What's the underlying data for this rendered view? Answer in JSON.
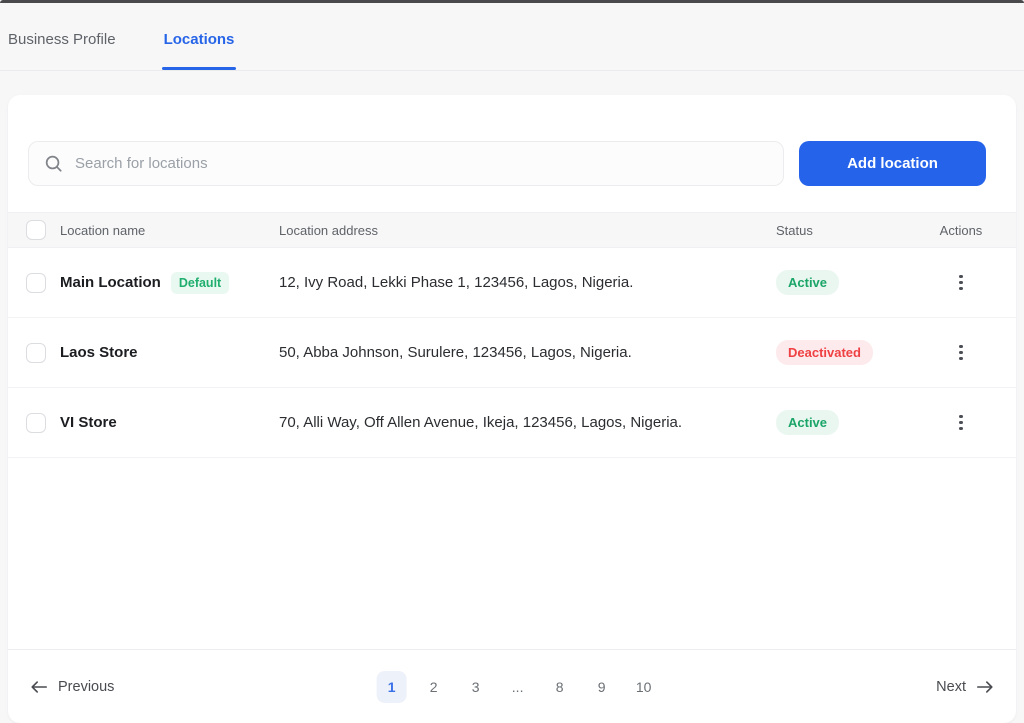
{
  "tabs": {
    "business_profile": {
      "label": "Business Profile",
      "active": false
    },
    "locations": {
      "label": "Locations",
      "active": true
    }
  },
  "search": {
    "placeholder": "Search for locations",
    "icon": "search-icon",
    "value": ""
  },
  "toolbar": {
    "add_location_label": "Add location"
  },
  "table": {
    "headers": {
      "name": "Location name",
      "address": "Location address",
      "status": "Status",
      "actions": "Actions"
    },
    "rows": [
      {
        "name": "Main Location",
        "badge": "Default",
        "address": "12, Ivy Road, Lekki Phase 1, 123456, Lagos, Nigeria.",
        "status": "Active",
        "status_type": "active"
      },
      {
        "name": "Laos Store",
        "badge": "",
        "address": "50, Abba Johnson,  Surulere, 123456, Lagos, Nigeria.",
        "status": "Deactivated",
        "status_type": "deactivated"
      },
      {
        "name": "VI Store",
        "badge": "",
        "address": "70, Alli Way, Off Allen Avenue, Ikeja, 123456, Lagos, Nigeria.",
        "status": "Active",
        "status_type": "active"
      }
    ]
  },
  "pagination": {
    "previous_label": "Previous",
    "next_label": "Next",
    "pages": [
      "1",
      "2",
      "3",
      "...",
      "8",
      "9",
      "10"
    ],
    "active_page": "1"
  },
  "colors": {
    "accent_blue": "#2563eb",
    "tab_active_blue": "#2765e8",
    "status_active_green": "#1ca568",
    "status_active_bg": "#eaf7f0",
    "status_deactivated_red": "#ef4043",
    "status_deactivated_bg": "#fdeaec",
    "default_badge_green": "#1fae6e",
    "default_badge_bg": "#e9f8f0",
    "page_background": "#f7f7f8",
    "card_background": "#ffffff",
    "pagination_active_bg": "#edf1fa",
    "pagination_active_text": "#3b71e8"
  }
}
